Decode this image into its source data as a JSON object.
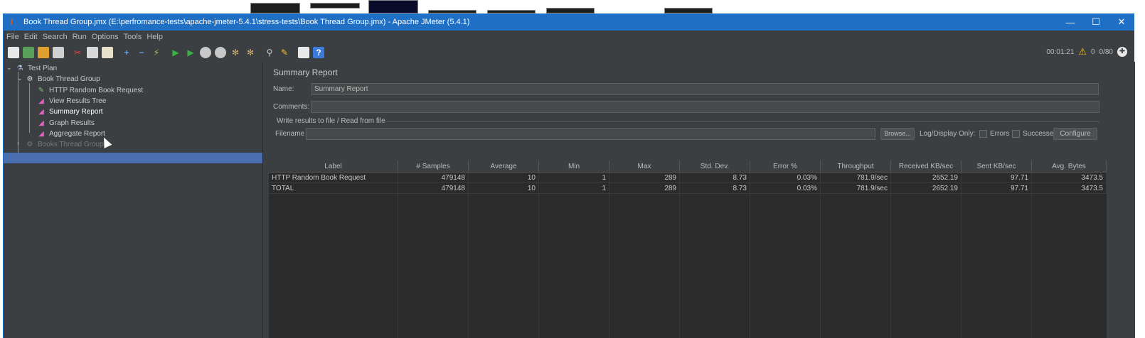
{
  "window": {
    "title": "Book Thread Group.jmx (E:\\perfromance-tests\\apache-jmeter-5.4.1\\stress-tests\\Book Thread Group.jmx) - Apache JMeter (5.4.1)",
    "minimize": "—",
    "maximize": "☐",
    "close": "✕"
  },
  "menu": [
    "File",
    "Edit",
    "Search",
    "Run",
    "Options",
    "Tools",
    "Help"
  ],
  "toolbar": {
    "elapsed": "00:01:21",
    "warnings": "0",
    "threads": "0/80"
  },
  "tree": {
    "test_plan": "Test Plan",
    "thread_group": "Book Thread Group",
    "items": [
      "HTTP Random Book Request",
      "View Results Tree",
      "Summary Report",
      "Graph Results",
      "Aggregate Report"
    ],
    "disabled_group": "Books Thread Group"
  },
  "panel": {
    "title": "Summary Report",
    "name_label": "Name:",
    "name_value": "Summary Report",
    "comments_label": "Comments:",
    "comments_value": "",
    "group_title": "Write results to file / Read from file",
    "filename_label": "Filename",
    "filename_value": "",
    "browse": "Browse...",
    "log_display": "Log/Display Only:",
    "errors": "Errors",
    "successes": "Successes",
    "configure": "Configure"
  },
  "table": {
    "headers": [
      "Label",
      "# Samples",
      "Average",
      "Min",
      "Max",
      "Std. Dev.",
      "Error %",
      "Throughput",
      "Received KB/sec",
      "Sent KB/sec",
      "Avg. Bytes"
    ],
    "rows": [
      [
        "HTTP Random Book Request",
        "479148",
        "10",
        "1",
        "289",
        "8.73",
        "0.03%",
        "781.9/sec",
        "2652.19",
        "97.71",
        "3473.5"
      ],
      [
        "TOTAL",
        "479148",
        "10",
        "1",
        "289",
        "8.73",
        "0.03%",
        "781.9/sec",
        "2652.19",
        "97.71",
        "3473.5"
      ]
    ]
  },
  "colors": {
    "titlebar": "#1f6fc5",
    "background": "#3c3f41",
    "table_bg": "#2b2b2b",
    "selection": "#4b6eaf"
  }
}
